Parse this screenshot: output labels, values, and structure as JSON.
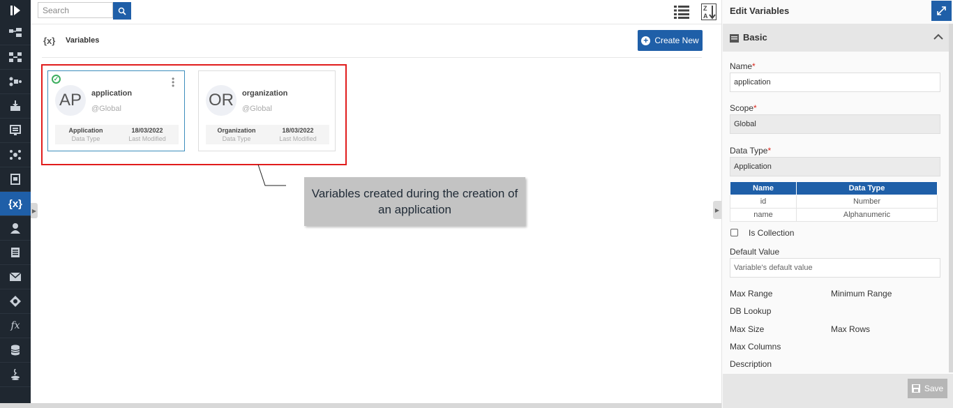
{
  "search": {
    "placeholder": "Search"
  },
  "header": {
    "title_icon": "{x}",
    "title": "Variables",
    "create_label": "Create New"
  },
  "cards": [
    {
      "initials": "AP",
      "name": "application",
      "scope": "@Global",
      "data_type": "Application",
      "data_type_label": "Data Type",
      "modified": "18/03/2022",
      "modified_label": "Last Modified"
    },
    {
      "initials": "OR",
      "name": "organization",
      "scope": "@Global",
      "data_type": "Organization",
      "data_type_label": "Data Type",
      "modified": "18/03/2022",
      "modified_label": "Last Modified"
    }
  ],
  "callout": {
    "text": "Variables created during the creation of an application"
  },
  "panel": {
    "title": "Edit Variables",
    "section": "Basic",
    "name_label": "Name",
    "name_value": "application",
    "scope_label": "Scope",
    "scope_value": "Global",
    "datatype_label": "Data Type",
    "datatype_value": "Application",
    "required_mark": "*",
    "table": {
      "headers": [
        "Name",
        "Data Type"
      ],
      "rows": [
        [
          "id",
          "Number"
        ],
        [
          "name",
          "Alphanumeric"
        ]
      ]
    },
    "collection_label": "Is Collection",
    "default_label": "Default Value",
    "default_placeholder": "Variable's default value",
    "max_range": "Max Range",
    "min_range": "Minimum Range",
    "db_lookup": "DB Lookup",
    "max_size": "Max Size",
    "max_rows": "Max Rows",
    "max_columns": "Max Columns",
    "description": "Description",
    "save_label": "Save"
  },
  "nav": [
    "logo-icon",
    "flow-icon",
    "process-icon",
    "integration-icon",
    "import-icon",
    "form-icon",
    "network-icon",
    "report-icon",
    "variables-icon",
    "user-icon",
    "document-icon",
    "mail-icon",
    "rules-icon",
    "function-icon",
    "database-icon",
    "java-icon"
  ]
}
